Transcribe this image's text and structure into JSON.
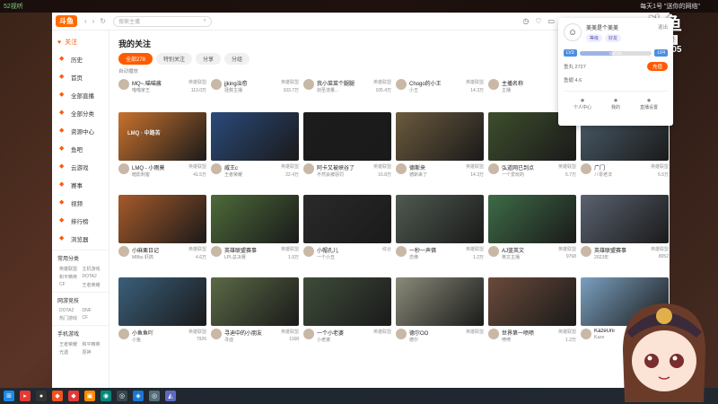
{
  "stream": {
    "site_label": "52视听",
    "overlay_text": "每天1号 \"送你的网络\"",
    "watermark_logo": "斗鱼",
    "watermark_room_label": "房间号",
    "watermark_room_number": "3849405"
  },
  "app": {
    "logo": "斗鱼",
    "search_placeholder": "搜索主播",
    "sidebar": {
      "user_label": "关注",
      "items": [
        {
          "label": "历史",
          "icon": "clock-icon"
        },
        {
          "label": "首页",
          "icon": "home-icon"
        },
        {
          "label": "全部直播",
          "icon": "live-icon"
        },
        {
          "label": "全部分类",
          "icon": "grid-icon"
        },
        {
          "label": "资源中心",
          "icon": "folder-icon"
        },
        {
          "label": "鱼吧",
          "icon": "fish-icon"
        },
        {
          "label": "云游戏",
          "icon": "cloud-icon"
        },
        {
          "label": "赛事",
          "icon": "trophy-icon"
        },
        {
          "label": "视频",
          "icon": "video-icon"
        },
        {
          "label": "排行榜",
          "icon": "rank-icon"
        },
        {
          "label": "浏览器",
          "icon": "browser-icon"
        }
      ],
      "section_common": "常用分类",
      "common_tags": [
        "英雄联盟",
        "主机游戏",
        "和平精英",
        "DOTA2",
        "CF",
        "王者荣耀"
      ],
      "section_online": "网游竞技",
      "online_tags": [
        "DOTA2",
        "DNF",
        "热门游戏",
        "CF"
      ],
      "section_mobile": "手机游戏",
      "mobile_tags": [
        "王者荣耀",
        "和平精英",
        "光遇",
        "原神"
      ]
    },
    "main": {
      "title": "我的关注",
      "filters": [
        "全部278",
        "特别关注",
        "分享",
        "分组"
      ],
      "auto_play": "自动播放",
      "top_row": [
        {
          "title": "MQ~.喵喵酱",
          "category": "英雄联盟",
          "name": "喵喵家王",
          "views": "113.0万"
        },
        {
          "title": "jjking治愈",
          "category": "英雄联盟",
          "name": "拯救主播",
          "views": "103.7万"
        },
        {
          "title": "我小菜菜个腿腿",
          "category": "英雄联盟",
          "name": "剑圣流量...",
          "views": "105.4万"
        },
        {
          "title": "Chogo的小王",
          "category": "英雄联盟",
          "name": "小王",
          "views": "14.3万"
        },
        {
          "title": "主播名称",
          "category": "英雄联盟",
          "name": "主播",
          "views": "7.8万"
        },
        {
          "title": "...",
          "category": "英雄联盟",
          "name": "...",
          "views": "41.3万"
        }
      ],
      "cards": [
        {
          "title": "LMQ - 小雨莫",
          "category": "英雄联盟",
          "name": "暗影刺客",
          "views": "41.5万",
          "thumb_text": "LMQ · 中路苦"
        },
        {
          "title": "威王c",
          "category": "英雄联盟",
          "name": "王者荣耀",
          "views": "22.4万",
          "thumb_text": ""
        },
        {
          "title": "阿卡又被峡谷了",
          "category": "英雄联盟",
          "name": "不然会被惩罚",
          "views": "16.8万",
          "thumb_text": ""
        },
        {
          "title": "德斯来",
          "category": "英雄联盟",
          "name": "德斯来了",
          "views": "14.3万",
          "thumb_text": ""
        },
        {
          "title": "弘道网已到点",
          "category": "英雄联盟",
          "name": "一个爱玩的",
          "views": "5.7万",
          "thumb_text": ""
        },
        {
          "title": "广门",
          "category": "英雄联盟",
          "name": "八零老法",
          "views": "5.5万",
          "thumb_text": ""
        },
        {
          "title": "小麻栗日记",
          "category": "英雄联盟",
          "name": "M8bu 虾搞",
          "views": "4.6万",
          "thumb_text": ""
        },
        {
          "title": "英雄联盟赛事",
          "category": "英雄联盟",
          "name": "LPL总决赛",
          "views": "1.9万",
          "thumb_text": ""
        },
        {
          "title": "小帽孔儿",
          "category": "综合",
          "name": "一个小丑",
          "views": "",
          "thumb_text": ""
        },
        {
          "title": "一秒一声佛",
          "category": "英雄联盟",
          "name": "念佛",
          "views": "1.2万",
          "thumb_text": ""
        },
        {
          "title": "AJ蓝英文",
          "category": "英雄联盟",
          "name": "英文主播",
          "views": "9768",
          "thumb_text": ""
        },
        {
          "title": "英雄联盟赛事",
          "category": "英雄联盟",
          "name": "2023年",
          "views": "8052",
          "thumb_text": ""
        },
        {
          "title": "小鱼鱼吖",
          "category": "英雄联盟",
          "name": "小鱼",
          "views": "7926",
          "thumb_text": ""
        },
        {
          "title": "寻迪中的小朋友",
          "category": "英雄联盟",
          "name": "寻迪",
          "views": "1168",
          "thumb_text": ""
        },
        {
          "title": "一个小老婆",
          "category": "英雄联盟",
          "name": "小老婆",
          "views": "",
          "thumb_text": ""
        },
        {
          "title": "德尔OO",
          "category": "英雄联盟",
          "name": "德尔",
          "views": "",
          "thumb_text": ""
        },
        {
          "title": "世界第一喷喷",
          "category": "英雄联盟",
          "name": "喷喷",
          "views": "1.2万",
          "thumb_text": ""
        },
        {
          "title": "KazeUni",
          "category": "英雄联盟",
          "name": "Kaze",
          "views": "",
          "thumb_text": ""
        }
      ]
    },
    "popup": {
      "name": "美美是个美美",
      "exit": "退出",
      "badges": [
        "等级",
        "好友"
      ],
      "level_left": "LV3",
      "level_right": "LV4",
      "level_text": "54/100",
      "level_progress": 0.45,
      "fish_balls": "鱼丸 2727",
      "fish_wings": "鱼翅 4.6",
      "recharge": "充值",
      "links": [
        {
          "label": "个人中心",
          "icon": "user-icon"
        },
        {
          "label": "我的",
          "icon": "heart-icon"
        },
        {
          "label": "直播设置",
          "icon": "settings-icon"
        }
      ]
    }
  },
  "colors": {
    "accent": "#ff5a00",
    "level_blue": "#4a8fe0"
  }
}
